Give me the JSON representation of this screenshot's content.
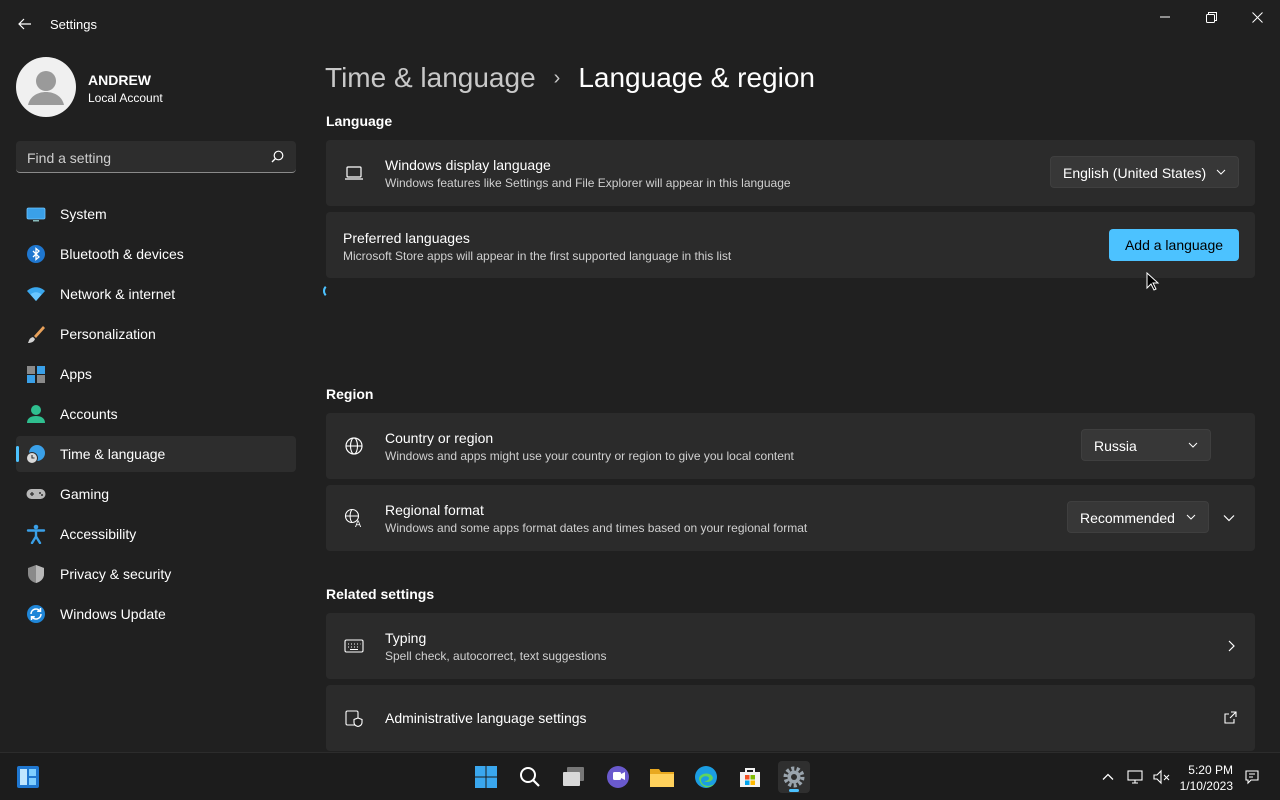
{
  "window": {
    "title": "Settings"
  },
  "profile": {
    "name": "ANDREW",
    "account_type": "Local Account"
  },
  "search": {
    "placeholder": "Find a setting"
  },
  "nav": {
    "items": [
      {
        "label": "System",
        "icon": "system-icon"
      },
      {
        "label": "Bluetooth & devices",
        "icon": "bluetooth-icon"
      },
      {
        "label": "Network & internet",
        "icon": "wifi-icon"
      },
      {
        "label": "Personalization",
        "icon": "brush-icon"
      },
      {
        "label": "Apps",
        "icon": "apps-icon"
      },
      {
        "label": "Accounts",
        "icon": "person-icon"
      },
      {
        "label": "Time & language",
        "icon": "globe-clock-icon",
        "active": true
      },
      {
        "label": "Gaming",
        "icon": "gamepad-icon"
      },
      {
        "label": "Accessibility",
        "icon": "accessibility-icon"
      },
      {
        "label": "Privacy & security",
        "icon": "shield-icon"
      },
      {
        "label": "Windows Update",
        "icon": "update-icon"
      }
    ]
  },
  "breadcrumb": {
    "parent": "Time & language",
    "separator": "›",
    "current": "Language & region"
  },
  "language_section": {
    "title": "Language",
    "display_language": {
      "title": "Windows display language",
      "description": "Windows features like Settings and File Explorer will appear in this language",
      "value": "English (United States)"
    },
    "preferred": {
      "title": "Preferred languages",
      "description": "Microsoft Store apps will appear in the first supported language in this list",
      "button": "Add a language"
    }
  },
  "region_section": {
    "title": "Region",
    "country": {
      "title": "Country or region",
      "description": "Windows and apps might use your country or region to give you local content",
      "value": "Russia"
    },
    "format": {
      "title": "Regional format",
      "description": "Windows and some apps format dates and times based on your regional format",
      "value": "Recommended"
    }
  },
  "related_section": {
    "title": "Related settings",
    "typing": {
      "title": "Typing",
      "description": "Spell check, autocorrect, text suggestions"
    },
    "admin": {
      "title": "Administrative language settings"
    }
  },
  "taskbar": {
    "time": "5:20 PM",
    "date": "1/10/2023"
  },
  "colors": {
    "accent": "#4cc2ff",
    "background": "#202020",
    "card": "#2b2b2b"
  }
}
